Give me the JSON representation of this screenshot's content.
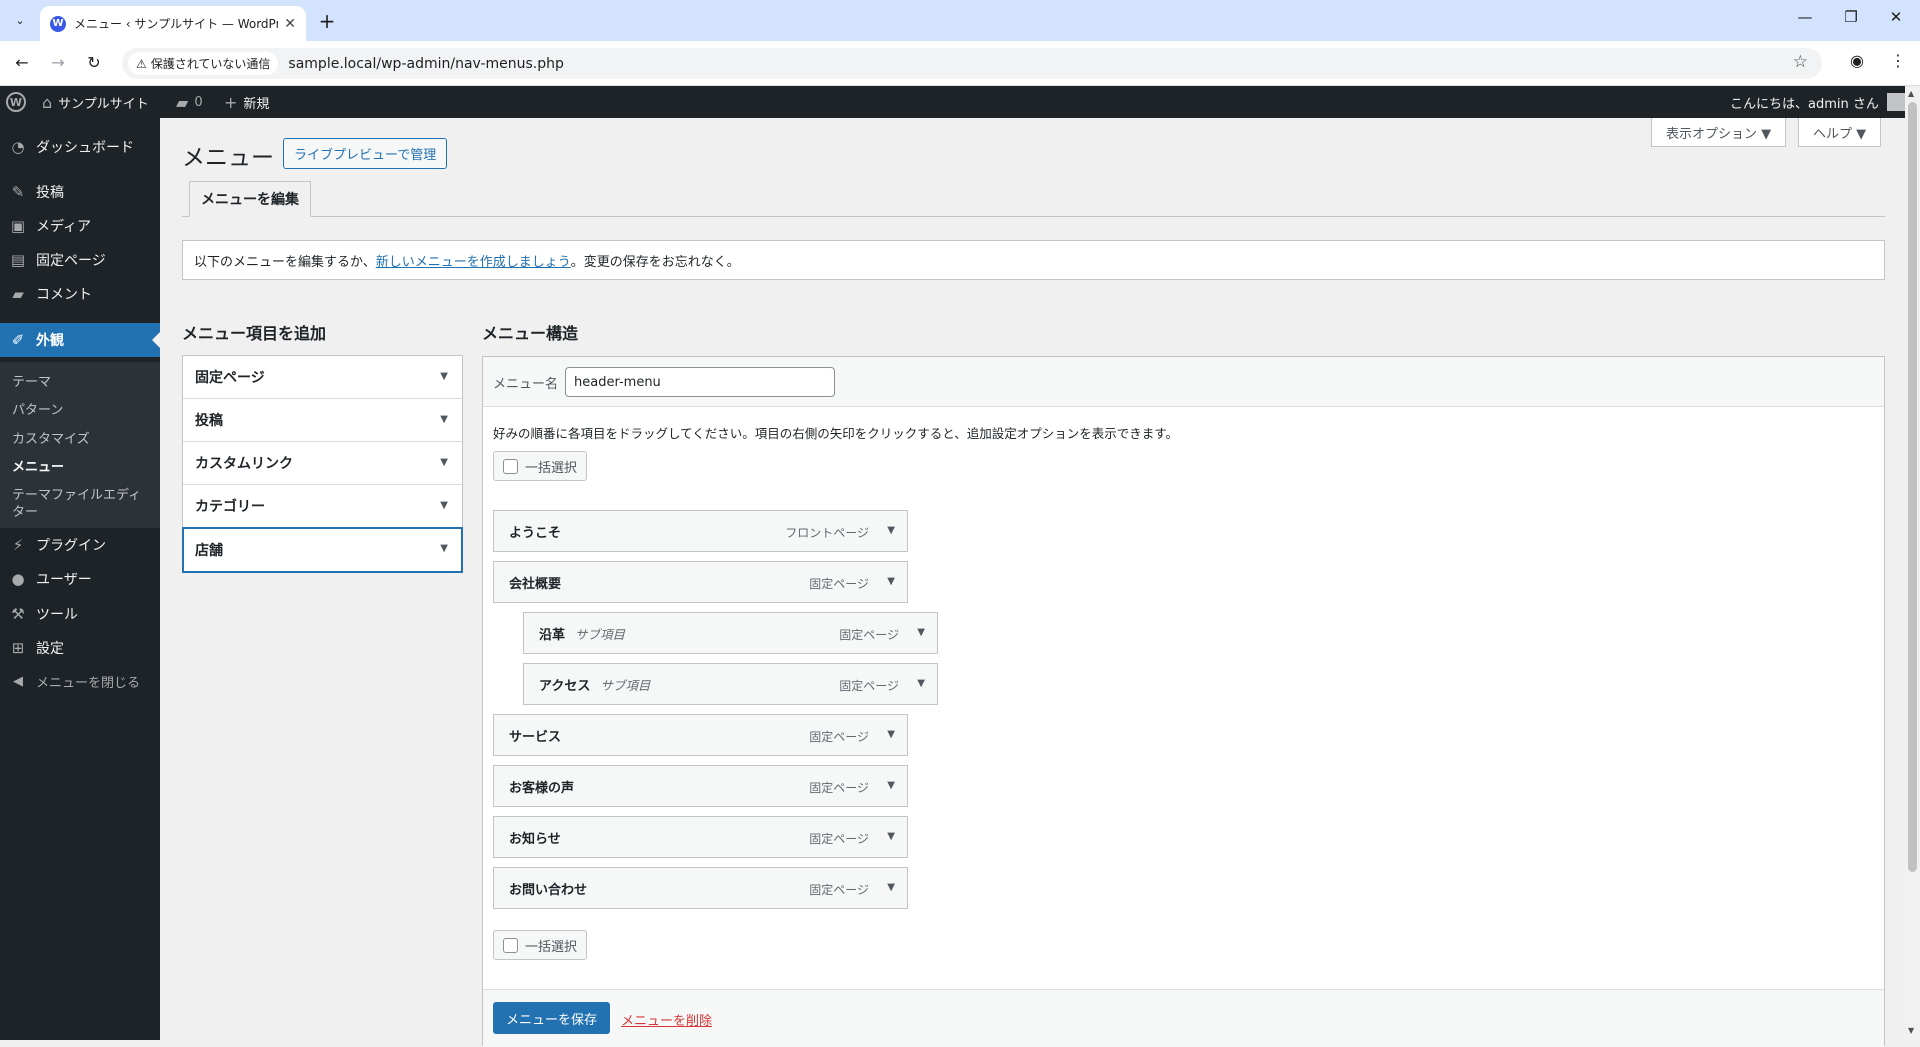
{
  "browser": {
    "tab_title": "メニュー ‹ サンプルサイト — WordPress",
    "security_label": "保護されていない通信",
    "url": "sample.local/wp-admin/nav-menus.php"
  },
  "adminbar": {
    "site_name": "サンプルサイト",
    "comments_count": "0",
    "new_label": "新規",
    "greeting": "こんにちは、admin さん"
  },
  "sidebar": {
    "items": [
      {
        "label": "ダッシュボード",
        "icon": "dashboard-icon"
      },
      {
        "label": "投稿",
        "icon": "pin-icon"
      },
      {
        "label": "メディア",
        "icon": "media-icon"
      },
      {
        "label": "固定ページ",
        "icon": "page-icon"
      },
      {
        "label": "コメント",
        "icon": "comment-icon"
      },
      {
        "label": "外観",
        "icon": "brush-icon"
      },
      {
        "label": "プラグイン",
        "icon": "plugin-icon"
      },
      {
        "label": "ユーザー",
        "icon": "user-icon"
      },
      {
        "label": "ツール",
        "icon": "wrench-icon"
      },
      {
        "label": "設定",
        "icon": "settings-icon"
      }
    ],
    "appearance_sub": [
      "テーマ",
      "パターン",
      "カスタマイズ",
      "メニュー",
      "テーマファイルエディター"
    ],
    "collapse_label": "メニューを閉じる"
  },
  "main": {
    "screen_options": "表示オプション ▼",
    "help": "ヘルプ ▼",
    "title": "メニュー",
    "live_preview": "ライブプレビューで管理",
    "edit_tab": "メニューを編集",
    "notice_prefix": "以下のメニューを編集するか、",
    "notice_link": "新しいメニューを作成しましょう",
    "notice_suffix": "。変更の保存をお忘れなく。",
    "add_items_heading": "メニュー項目を追加",
    "add_items": [
      "固定ページ",
      "投稿",
      "カスタムリンク",
      "カテゴリー",
      "店舗"
    ],
    "structure_heading": "メニュー構造",
    "menu_name_label": "メニュー名",
    "menu_name_value": "header-menu",
    "instructions": "好みの順番に各項目をドラッグしてください。項目の右側の矢印をクリックすると、追加設定オプションを表示できます。",
    "bulk_select": "一括選択",
    "menu_items": [
      {
        "title": "ようこそ",
        "sub": "",
        "type": "フロントページ"
      },
      {
        "title": "会社概要",
        "sub": "",
        "type": "固定ページ"
      },
      {
        "title": "沿革",
        "sub": "サブ項目",
        "type": "固定ページ"
      },
      {
        "title": "アクセス",
        "sub": "サブ項目",
        "type": "固定ページ"
      },
      {
        "title": "サービス",
        "sub": "",
        "type": "固定ページ"
      },
      {
        "title": "お客様の声",
        "sub": "",
        "type": "固定ページ"
      },
      {
        "title": "お知らせ",
        "sub": "",
        "type": "固定ページ"
      },
      {
        "title": "お問い合わせ",
        "sub": "",
        "type": "固定ページ"
      }
    ],
    "save_button": "メニューを保存",
    "delete_link": "メニューを削除"
  }
}
